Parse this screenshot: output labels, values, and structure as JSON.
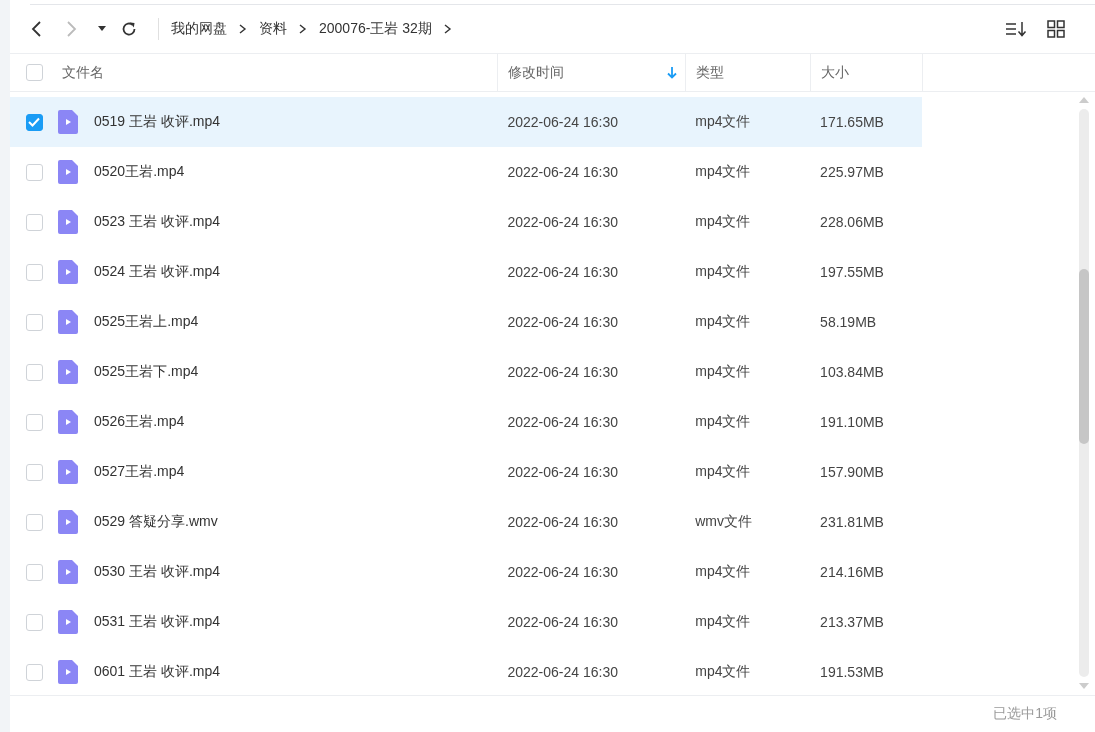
{
  "breadcrumb": [
    "我的网盘",
    "资料",
    "200076-王岩 32期"
  ],
  "columns": [
    {
      "label": "文件名",
      "sorted": false
    },
    {
      "label": "修改时间",
      "sorted": true
    },
    {
      "label": "类型",
      "sorted": false
    },
    {
      "label": "大小",
      "sorted": false
    }
  ],
  "all_checked": false,
  "rows": [
    {
      "name": "0519 王岩 收评.mp4",
      "modified": "2022-06-24 16:30",
      "type": "mp4文件",
      "size": "171.65MB",
      "selected": true
    },
    {
      "name": "0520王岩.mp4",
      "modified": "2022-06-24 16:30",
      "type": "mp4文件",
      "size": "225.97MB",
      "selected": false
    },
    {
      "name": "0523 王岩 收评.mp4",
      "modified": "2022-06-24 16:30",
      "type": "mp4文件",
      "size": "228.06MB",
      "selected": false
    },
    {
      "name": "0524 王岩 收评.mp4",
      "modified": "2022-06-24 16:30",
      "type": "mp4文件",
      "size": "197.55MB",
      "selected": false
    },
    {
      "name": "0525王岩上.mp4",
      "modified": "2022-06-24 16:30",
      "type": "mp4文件",
      "size": "58.19MB",
      "selected": false
    },
    {
      "name": "0525王岩下.mp4",
      "modified": "2022-06-24 16:30",
      "type": "mp4文件",
      "size": "103.84MB",
      "selected": false
    },
    {
      "name": "0526王岩.mp4",
      "modified": "2022-06-24 16:30",
      "type": "mp4文件",
      "size": "191.10MB",
      "selected": false
    },
    {
      "name": "0527王岩.mp4",
      "modified": "2022-06-24 16:30",
      "type": "mp4文件",
      "size": "157.90MB",
      "selected": false
    },
    {
      "name": "0529 答疑分享.wmv",
      "modified": "2022-06-24 16:30",
      "type": "wmv文件",
      "size": "231.81MB",
      "selected": false
    },
    {
      "name": "0530 王岩 收评.mp4",
      "modified": "2022-06-24 16:30",
      "type": "mp4文件",
      "size": "214.16MB",
      "selected": false
    },
    {
      "name": "0531 王岩 收评.mp4",
      "modified": "2022-06-24 16:30",
      "type": "mp4文件",
      "size": "213.37MB",
      "selected": false
    },
    {
      "name": "0601 王岩 收评.mp4",
      "modified": "2022-06-24 16:30",
      "type": "mp4文件",
      "size": "191.53MB",
      "selected": false
    }
  ],
  "status_bar": "已选中1项"
}
